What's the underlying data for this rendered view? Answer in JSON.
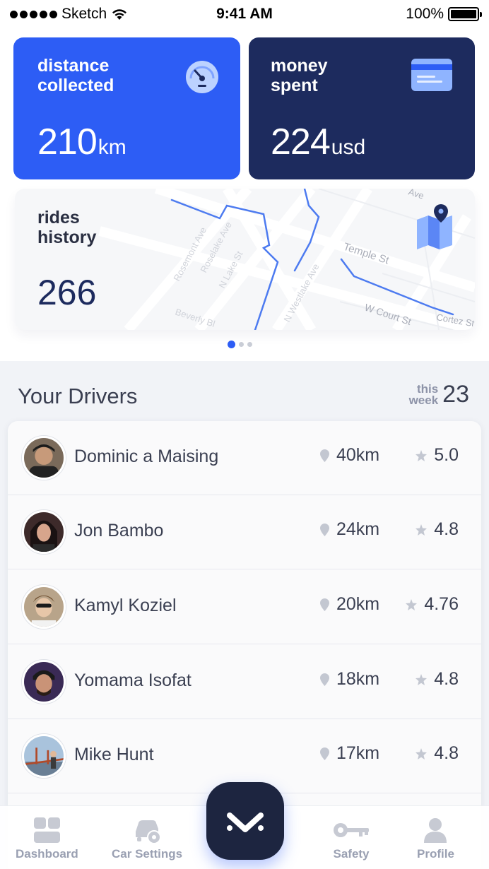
{
  "status_bar": {
    "carrier": "Sketch",
    "time": "9:41 AM",
    "battery": "100%"
  },
  "cards": {
    "distance": {
      "title": "distance\ncollected",
      "value": "210",
      "unit": "km",
      "icon": "speedometer-icon",
      "color": "#2d5df5"
    },
    "money": {
      "title": "money\nspent",
      "value": "224",
      "unit": "usd",
      "icon": "credit-card-icon",
      "color": "#1d2b5e"
    },
    "rides": {
      "title": "rides\nhistory",
      "value": "266",
      "icon": "map-pin-icon"
    }
  },
  "map_labels": [
    "Rosemont Ave",
    "Roselake Ave",
    "N Lake St",
    "N Westlake Ave",
    "Temple St",
    "W Court St",
    "Cortez St",
    "Beverly Bl",
    "Ave"
  ],
  "pager": {
    "count": 3,
    "active": 0
  },
  "drivers": {
    "title": "Your Drivers",
    "week_label": "this\nweek",
    "week_count": "23",
    "items": [
      {
        "name": "Dominic a Maising",
        "distance": "40km",
        "rating": "5.0"
      },
      {
        "name": "Jon Bambo",
        "distance": "24km",
        "rating": "4.8"
      },
      {
        "name": "Kamyl Koziel",
        "distance": "20km",
        "rating": "4.76"
      },
      {
        "name": "Yomama Isofat",
        "distance": "18km",
        "rating": "4.8"
      },
      {
        "name": "Mike Hunt",
        "distance": "17km",
        "rating": "4.8"
      }
    ]
  },
  "tabs": [
    {
      "label": "Dashboard",
      "icon": "dashboard-icon"
    },
    {
      "label": "Car Settings",
      "icon": "car-settings-icon"
    },
    {
      "label": "Safety",
      "icon": "key-icon"
    },
    {
      "label": "Profile",
      "icon": "person-icon"
    }
  ],
  "fab": {
    "icon": "chevron-down-icon"
  }
}
